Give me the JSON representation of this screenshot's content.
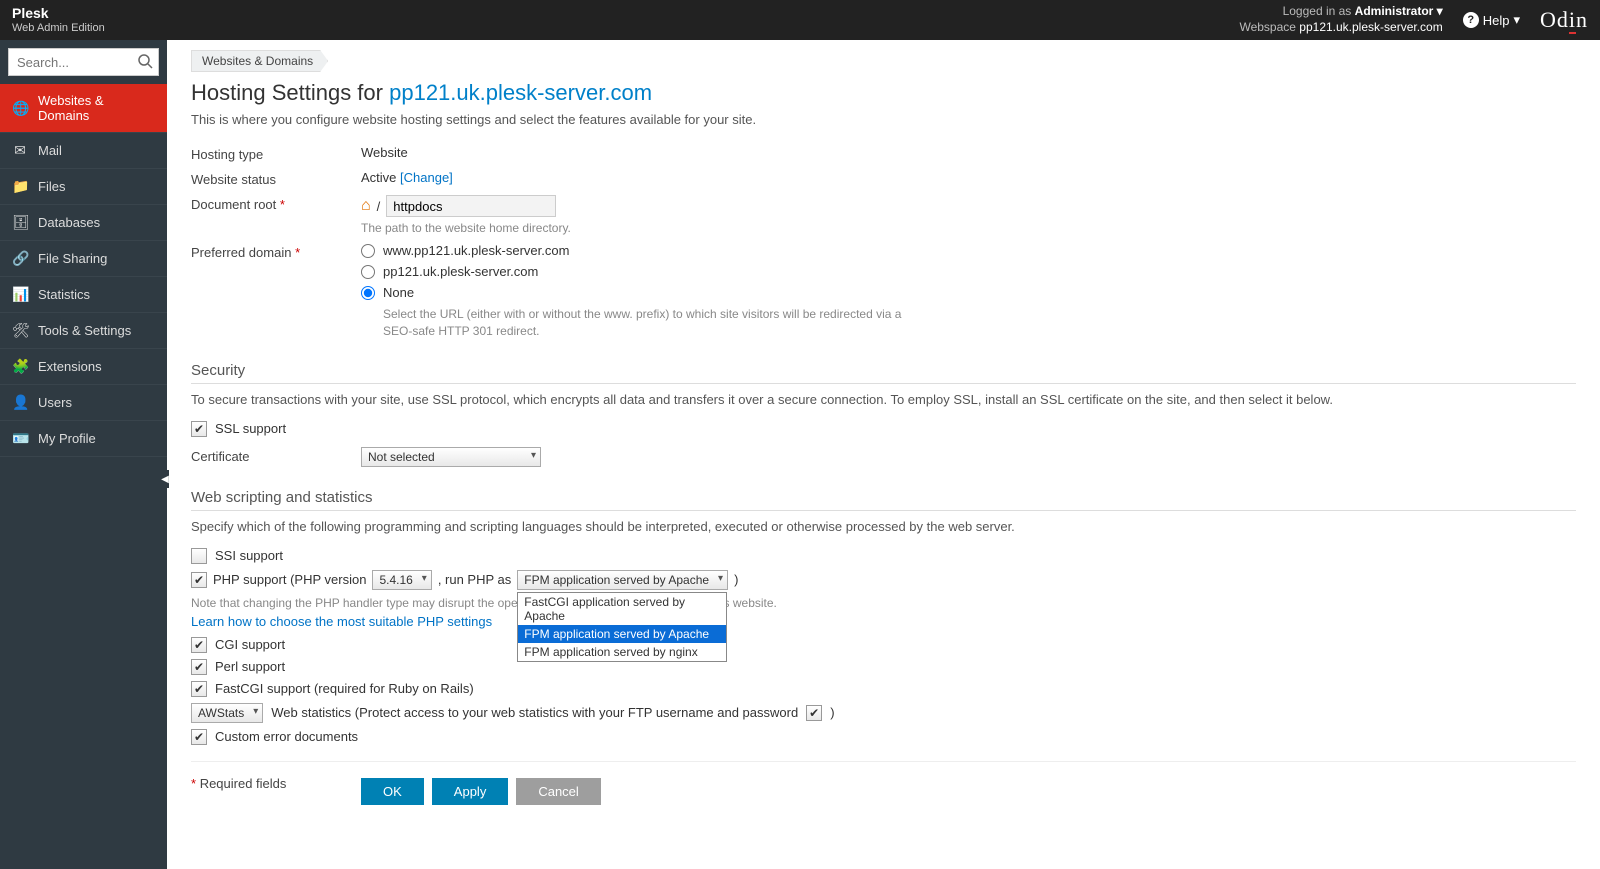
{
  "topbar": {
    "brand": "Plesk",
    "edition": "Web Admin Edition",
    "logged_in_as_label": "Logged in as",
    "admin": "Administrator",
    "webspace_label": "Webspace",
    "webspace": "pp121.uk.plesk-server.com",
    "help": "Help",
    "odin": "Odin"
  },
  "search": {
    "placeholder": "Search..."
  },
  "nav": {
    "items": [
      {
        "label": "Websites & Domains",
        "icon": "🌐",
        "active": true
      },
      {
        "label": "Mail",
        "icon": "✉"
      },
      {
        "label": "Files",
        "icon": "📁"
      },
      {
        "label": "Databases",
        "icon": "🗄"
      },
      {
        "label": "File Sharing",
        "icon": "🔗"
      },
      {
        "label": "Statistics",
        "icon": "📊"
      },
      {
        "label": "Tools & Settings",
        "icon": "🛠"
      },
      {
        "label": "Extensions",
        "icon": "🧩"
      },
      {
        "label": "Users",
        "icon": "👤"
      },
      {
        "label": "My Profile",
        "icon": "🪪"
      }
    ]
  },
  "breadcrumb": "Websites & Domains",
  "page": {
    "title_prefix": "Hosting Settings for ",
    "domain": "pp121.uk.plesk-server.com",
    "description": "This is where you configure website hosting settings and select the features available for your site."
  },
  "hosting": {
    "type_label": "Hosting type",
    "type_value": "Website",
    "status_label": "Website status",
    "status_value": "Active",
    "status_change": "[Change]",
    "docroot_label": "Document root",
    "docroot_prefix": "/",
    "docroot_value": "httpdocs",
    "docroot_hint": "The path to the website home directory.",
    "preferred_label": "Preferred domain",
    "preferred_options": [
      "www.pp121.uk.plesk-server.com",
      "pp121.uk.plesk-server.com",
      "None"
    ],
    "preferred_selected": "None",
    "preferred_hint": "Select the URL (either with or without the www. prefix) to which site visitors will be redirected via a SEO-safe HTTP 301 redirect."
  },
  "security": {
    "heading": "Security",
    "desc": "To secure transactions with your site, use SSL protocol, which encrypts all data and transfers it over a secure connection. To employ SSL, install an SSL certificate on the site, and then select it below.",
    "ssl_label": "SSL support",
    "cert_label": "Certificate",
    "cert_value": "Not selected"
  },
  "scripting": {
    "heading": "Web scripting and statistics",
    "desc": "Specify which of the following programming and scripting languages should be interpreted, executed or otherwise processed by the web server.",
    "ssi_label": "SSI support",
    "php_label_pre": "PHP support (PHP version",
    "php_version": "5.4.16",
    "php_label_mid": ", run PHP as",
    "php_handler": "FPM application served by Apache",
    "php_handler_options": [
      "FastCGI application served by Apache",
      "FPM application served by Apache",
      "FPM application served by nginx"
    ],
    "php_note": "Note that changing the PHP handler type may disrupt the operation of the existing PHP scripts on this website.",
    "php_learn": "Learn how to choose the most suitable PHP settings",
    "cgi_label": "CGI support",
    "perl_label": "Perl support",
    "fastcgi_label": "FastCGI support (required for Ruby on Rails)",
    "stats_value": "AWStats",
    "stats_label": "Web statistics (Protect access to your web statistics with your FTP username and password",
    "custom_err_label": "Custom error documents"
  },
  "footer": {
    "required": "Required fields",
    "ok": "OK",
    "apply": "Apply",
    "cancel": "Cancel"
  }
}
